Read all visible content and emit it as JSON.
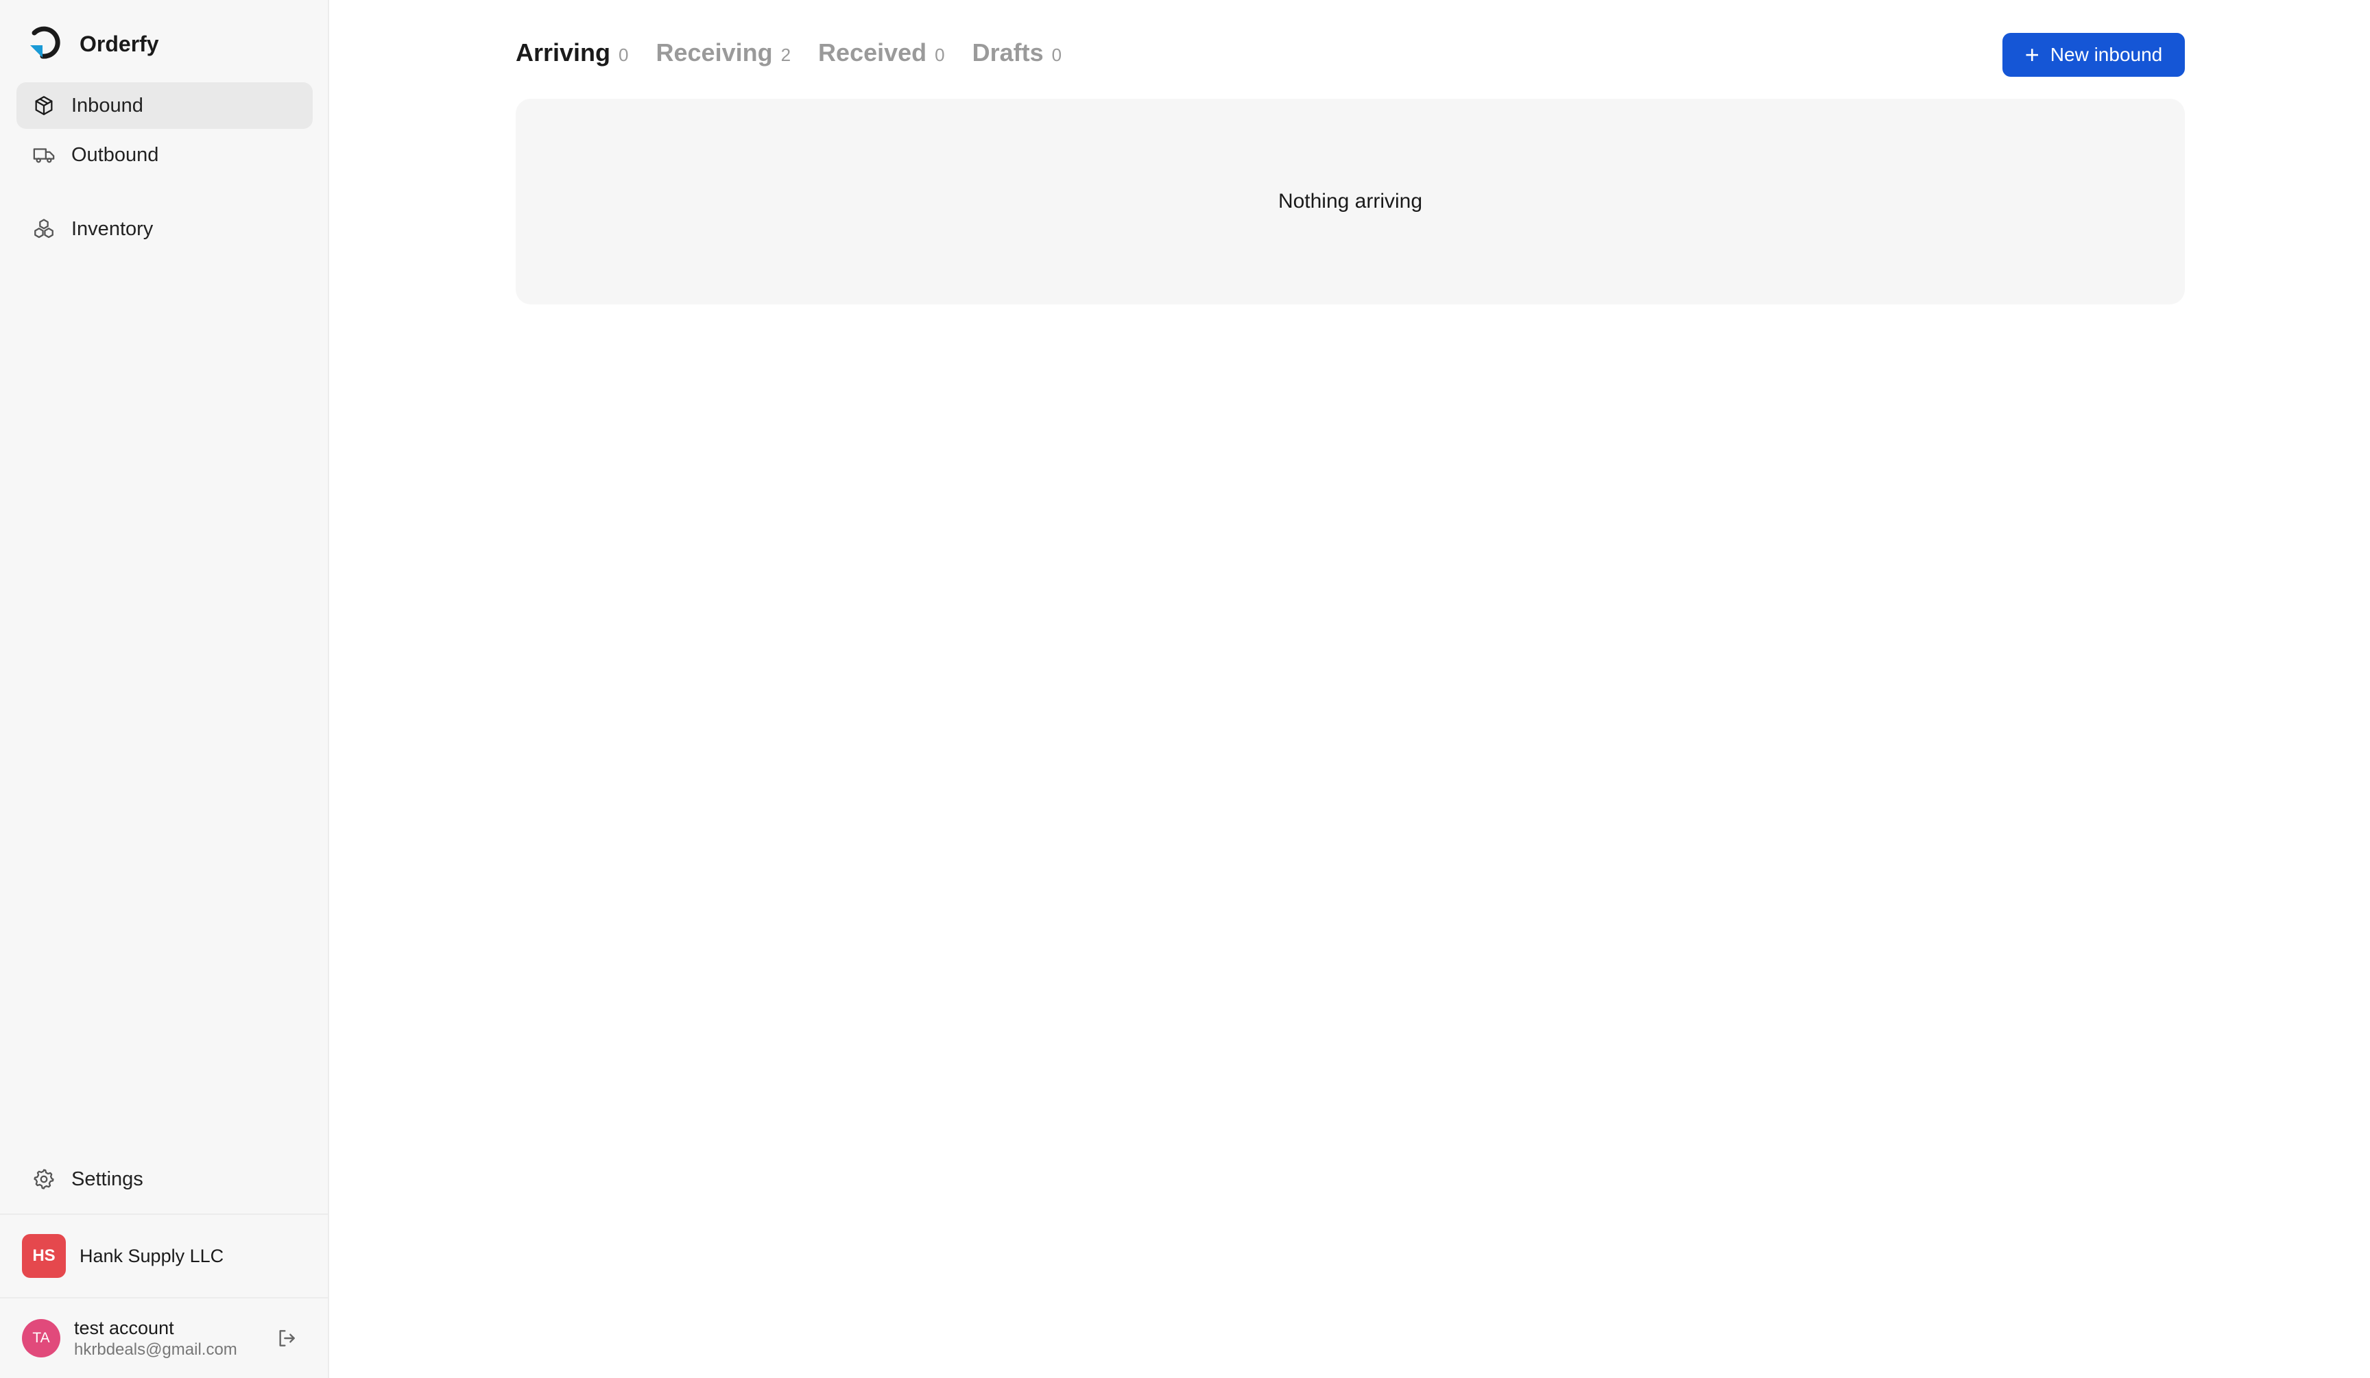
{
  "app": {
    "name": "Orderfy"
  },
  "sidebar": {
    "items": [
      {
        "label": "Inbound",
        "icon": "package-icon",
        "active": true
      },
      {
        "label": "Outbound",
        "icon": "truck-icon",
        "active": false
      },
      {
        "label": "Inventory",
        "icon": "boxes-icon",
        "active": false
      }
    ],
    "settings": {
      "label": "Settings",
      "icon": "gear-icon"
    },
    "organization": {
      "initials": "HS",
      "name": "Hank Supply LLC",
      "color": "#e5484d"
    },
    "user": {
      "initials": "TA",
      "name": "test account",
      "email": "hkrbdeals@gmail.com",
      "color": "#e14a7b"
    }
  },
  "main": {
    "tabs": [
      {
        "label": "Arriving",
        "count": "0",
        "active": true
      },
      {
        "label": "Receiving",
        "count": "2",
        "active": false
      },
      {
        "label": "Received",
        "count": "0",
        "active": false
      },
      {
        "label": "Drafts",
        "count": "0",
        "active": false
      }
    ],
    "new_button": {
      "label": "New inbound",
      "icon": "plus-icon",
      "color": "#1556d6"
    },
    "empty_state": "Nothing arriving"
  }
}
